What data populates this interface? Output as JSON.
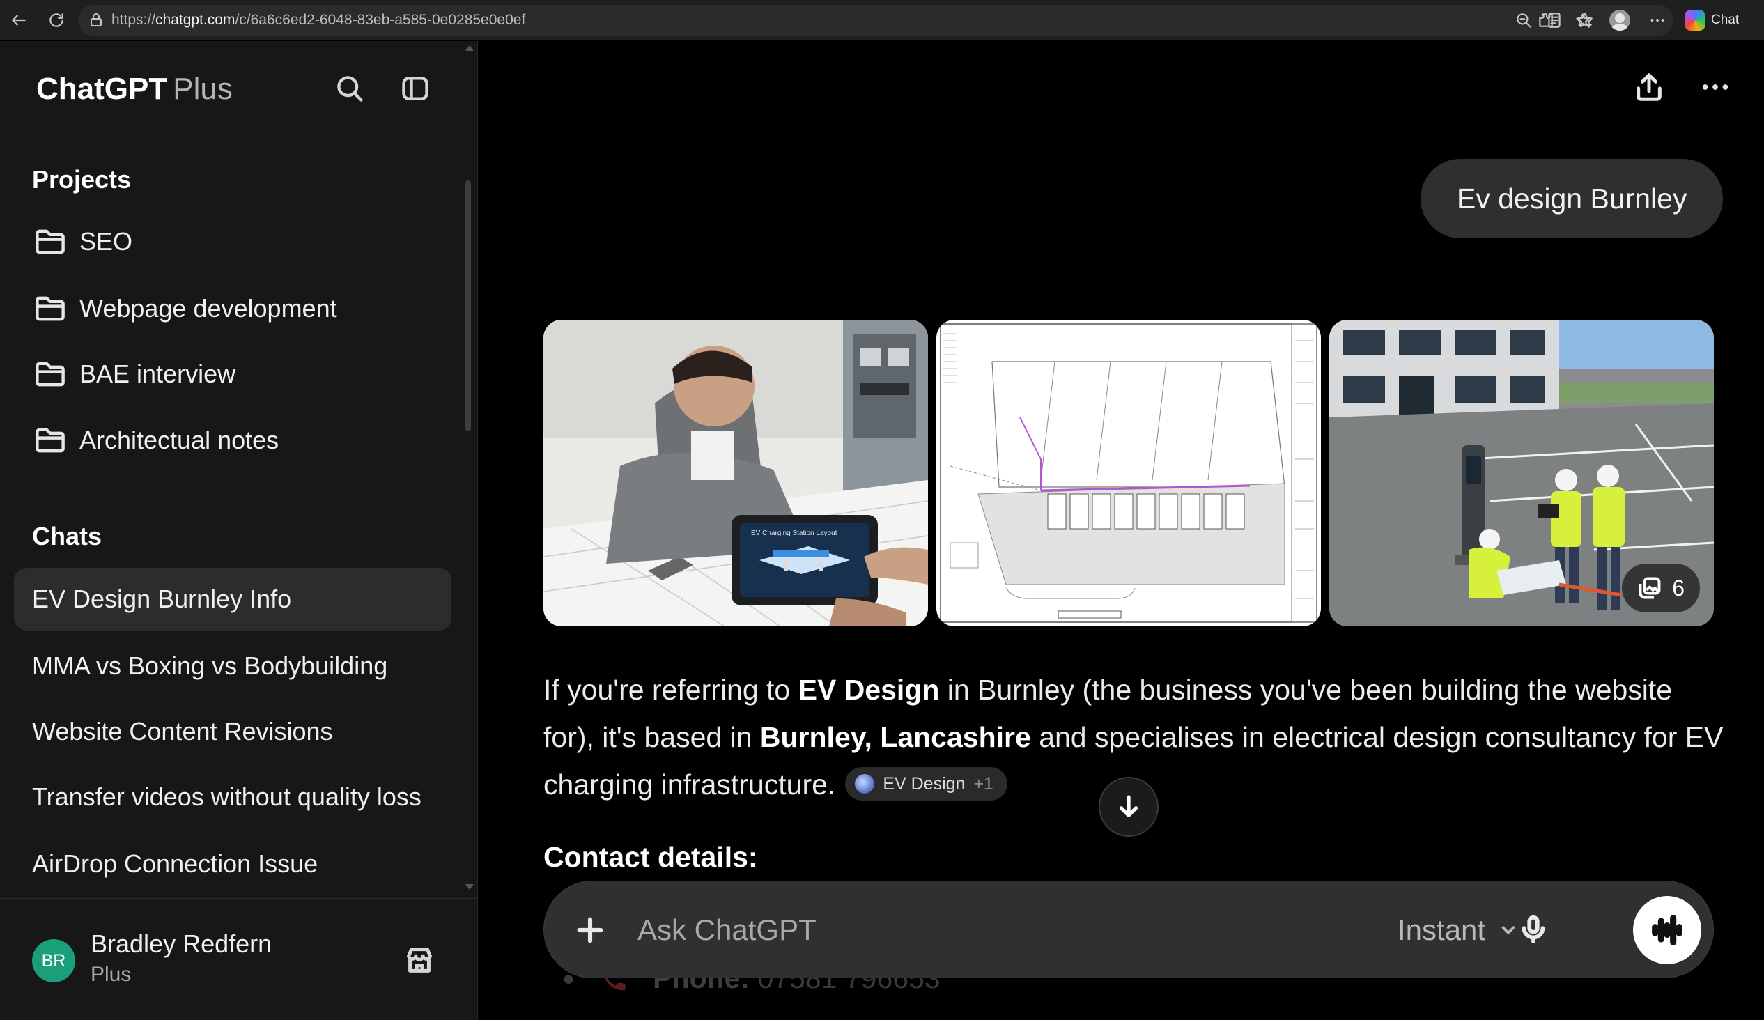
{
  "browser": {
    "url_scheme": "https://",
    "url_domain": "chatgpt.com",
    "url_path": "/c/6a6c6ed2-6048-83eb-a585-0e0285e0e0ef",
    "copilot_label": "Chat"
  },
  "sidebar": {
    "brand": "ChatGPT",
    "brand_plan": "Plus",
    "projects_title": "Projects",
    "projects": [
      {
        "label": "SEO"
      },
      {
        "label": "Webpage development"
      },
      {
        "label": "BAE interview"
      },
      {
        "label": "Architectual notes"
      }
    ],
    "chats_title": "Chats",
    "chats": [
      {
        "label": "EV Design Burnley Info",
        "active": true
      },
      {
        "label": "MMA vs Boxing vs Bodybuilding"
      },
      {
        "label": "Website Content Revisions"
      },
      {
        "label": "Transfer videos without quality loss"
      },
      {
        "label": "AirDrop Connection Issue"
      }
    ],
    "user": {
      "initials": "BR",
      "name": "Bradley Redfern",
      "plan": "Plus",
      "avatar_color": "#1a9f7a"
    }
  },
  "conversation": {
    "user_message": "Ev design Burnley",
    "image_extra_count": "6",
    "answer": {
      "p1": "If you're referring to ",
      "b1": "EV Design",
      "p2": " in Burnley (the business you've been building the website for), it's based in ",
      "b2": "Burnley, Lancashire",
      "p3": " and specialises in electrical design consultancy for EV charging infrastructure.",
      "citation": "EV Design",
      "citation_more": "+1"
    },
    "contact_heading": "Contact details:",
    "phone_label": "Phone:",
    "phone_value": "07581 796653"
  },
  "composer": {
    "placeholder": "Ask ChatGPT",
    "model": "Instant"
  },
  "colors": {
    "background": "#000000",
    "sidebar": "#171717",
    "active_chat": "#2c2c2c",
    "bubble": "#2f2f2f",
    "composer": "#303030"
  }
}
